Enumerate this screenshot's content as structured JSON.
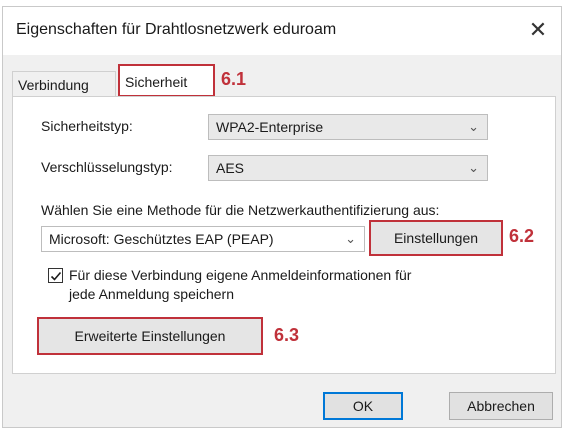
{
  "dialog": {
    "title": "Eigenschaften für Drahtlosnetzwerk eduroam",
    "close_glyph": "✕"
  },
  "tabs": [
    {
      "label": "Verbindung",
      "selected": false
    },
    {
      "label": "Sicherheit",
      "selected": true
    }
  ],
  "security": {
    "type_label": "Sicherheitstyp:",
    "type_value": "WPA2-Enterprise",
    "encryption_label": "Verschlüsselungstyp:",
    "encryption_value": "AES",
    "method_prompt": "Wählen Sie eine Methode für die Netzwerkauthentifizierung aus:",
    "method_value": "Microsoft: Geschütztes EAP (PEAP)",
    "settings_button": "Einstellungen",
    "remember_checkbox": {
      "checked": true,
      "line1": "Für diese Verbindung eigene Anmeldeinformationen für",
      "line2": "jede Anmeldung speichern"
    },
    "advanced_button": "Erweiterte Einstellungen"
  },
  "annotations": {
    "step_1": "6.1",
    "step_2": "6.2",
    "step_3": "6.3",
    "color": "#c0313a"
  },
  "footer": {
    "ok": "OK",
    "cancel": "Abbrechen"
  },
  "chevron_glyph": "⌄",
  "icons": {
    "dropdown": "chevron-down-icon",
    "check": "checkmark-icon",
    "close": "close-icon"
  }
}
